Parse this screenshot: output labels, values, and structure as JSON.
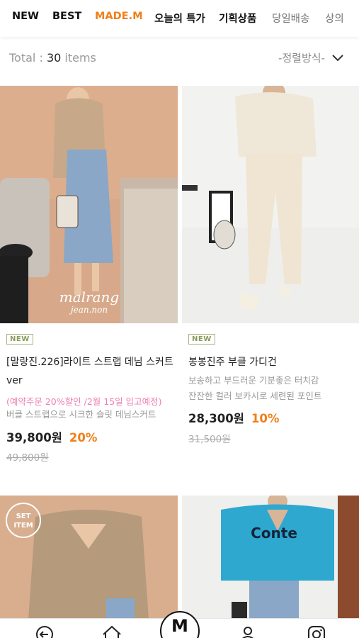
{
  "tabs": [
    {
      "label": "NEW"
    },
    {
      "label": "BEST"
    },
    {
      "label": "MADE.M"
    },
    {
      "label": "오늘의 특가"
    },
    {
      "label": "기획상품"
    },
    {
      "label": "당일배송"
    },
    {
      "label": "상의"
    }
  ],
  "toolbar": {
    "total_label": "Total :",
    "total_count": "30",
    "total_unit": "items",
    "sort_label": "-정렬방식-"
  },
  "products": [
    {
      "badge": "NEW",
      "name": "[말랑진.226]라이트 스트랩 데님 스커트ver",
      "promo": "(예약주문 20%할인 /2월 15일 입고예정)",
      "desc": "버클 스트랩으로 시크한 슬릿 데님스커트",
      "price": "39,800원",
      "discount": "20%",
      "original_price": "49,800원",
      "watermark_line1": "malrang",
      "watermark_line2": "jean.non"
    },
    {
      "badge": "NEW",
      "name": "봉봉진주 부클 가디건",
      "desc_line1": "보송하고 부드러운 기분좋은 터치감",
      "desc_line2": "잔잔한 컬러 보카시로 세련된 포인트",
      "price": "28,300원",
      "discount": "10%",
      "original_price": "31,500원"
    }
  ],
  "row2": {
    "set_badge_line1": "SET",
    "set_badge_line2": "ITEM",
    "sweatshirt_text": "Conte"
  },
  "colors": {
    "accent": "#f07f1a",
    "promo": "#ef7fb0",
    "badge": "#8a9a5e"
  },
  "bottom_nav": {
    "center_label": "M",
    "icons": [
      "back-icon",
      "home-icon",
      "logo-m-icon",
      "user-icon",
      "instagram-icon"
    ]
  }
}
